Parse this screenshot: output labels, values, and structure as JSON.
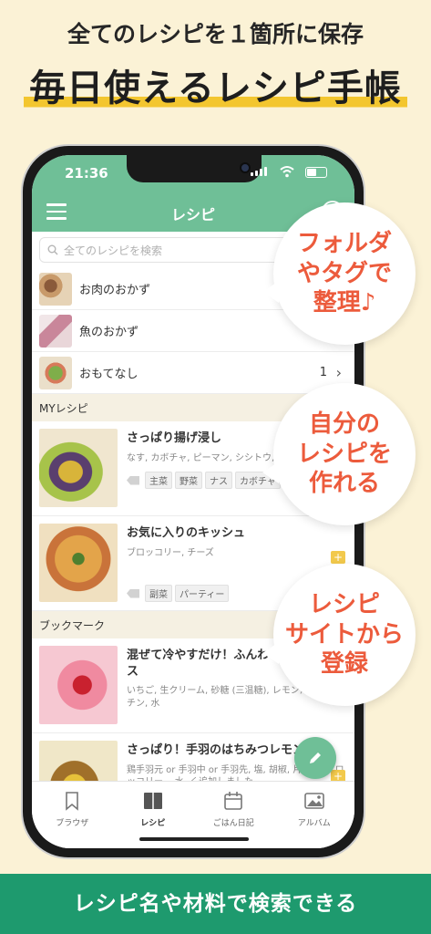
{
  "hero": {
    "subtitle": "全てのレシピを１箇所に保存",
    "title": "毎日使えるレシピ手帳"
  },
  "status_bar": {
    "time": "21:36"
  },
  "app_bar": {
    "title": "レシピ"
  },
  "search": {
    "placeholder": "全てのレシピを検索"
  },
  "folders": [
    {
      "label": "お肉のおかず",
      "count": ""
    },
    {
      "label": "魚のおかず",
      "count": ""
    },
    {
      "label": "おもてなし",
      "count": "1"
    }
  ],
  "sections": {
    "my_recipes": "MYレシピ",
    "bookmarks": "ブックマーク"
  },
  "my_recipes": [
    {
      "title": "さっぱり揚げ浸し",
      "ingredients": "なす, カボチャ, ピーマン, シシトウ, 醤油",
      "tags": [
        "主菜",
        "野菜",
        "ナス",
        "カボチャ"
      ]
    },
    {
      "title": "お気に入りのキッシュ",
      "ingredients": "ブロッコリー, チーズ",
      "tags": [
        "副菜",
        "パーティー"
      ]
    }
  ],
  "bookmarks": [
    {
      "title": "混ぜて冷やすだけ！ふんわりいちごムース",
      "ingredients": "いちご, 生クリーム, 砂糖 (三温糖), レモン汁, 粉ゼラチン, 水"
    },
    {
      "title": "さっぱり！手羽のはちみつレモン煮",
      "ingredients": "鶏手羽元 or 手羽中 or 手羽先, 塩, 胡椒, 片栗粉, ブロッコリー, , 水, く追加しました…"
    }
  ],
  "tabs": [
    {
      "label": "ブラウザ",
      "icon": "bookmark-icon"
    },
    {
      "label": "レシピ",
      "icon": "book-icon"
    },
    {
      "label": "ごはん日記",
      "icon": "calendar-icon"
    },
    {
      "label": "アルバム",
      "icon": "photo-icon"
    }
  ],
  "callouts": [
    {
      "lines": [
        "フォルダ",
        "やタグで",
        "整理♪"
      ]
    },
    {
      "lines": [
        "自分の",
        "レシピを",
        "作れる"
      ]
    },
    {
      "lines": [
        "レシピ",
        "サイトから",
        "登録"
      ]
    }
  ],
  "footer": {
    "text": "レシピ名や材料で検索できる"
  },
  "colors": {
    "accent": "#6fbf97",
    "callout_text": "#ec5b3c",
    "footer_bg": "#1e9a6e",
    "highlight": "#f3c62f"
  }
}
